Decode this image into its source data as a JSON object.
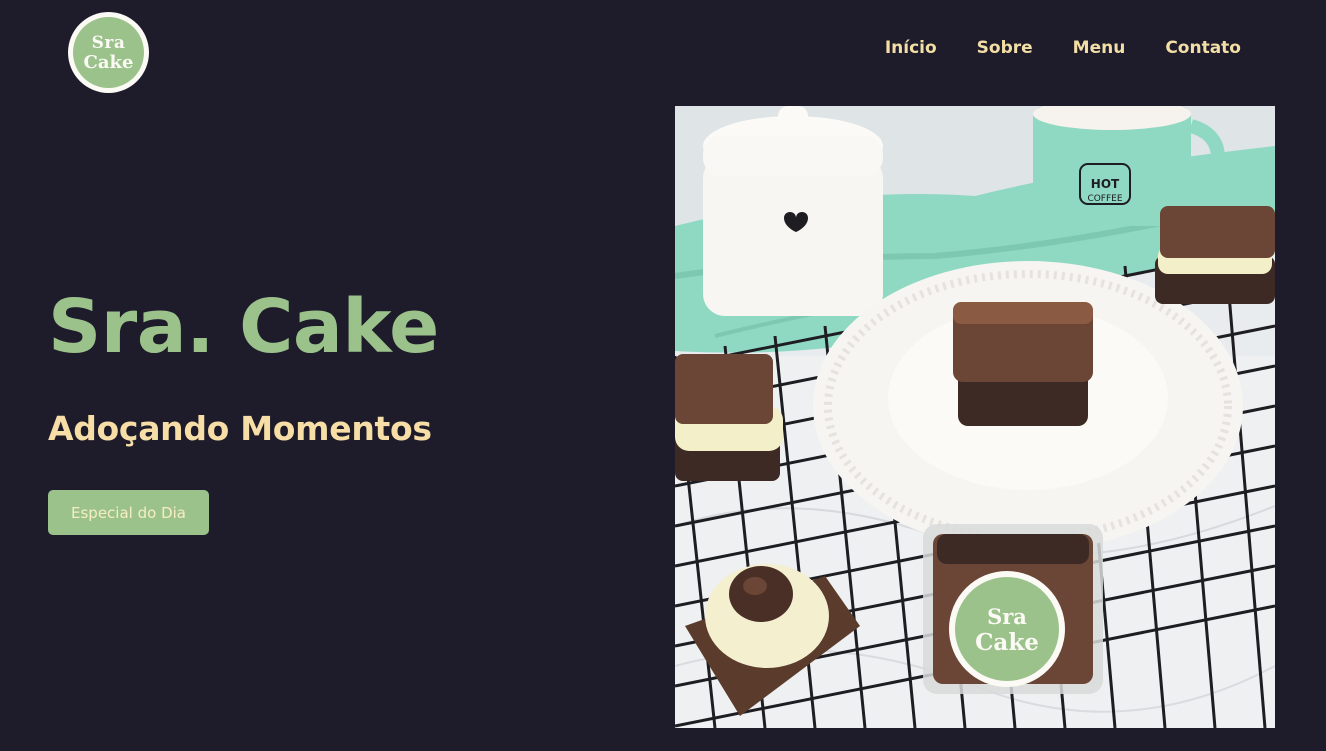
{
  "brand": {
    "logo_line1": "Sra",
    "logo_line2": "Cake"
  },
  "nav": {
    "items": [
      "Início",
      "Sobre",
      "Menu",
      "Contato"
    ]
  },
  "hero": {
    "title": "Sra. Cake",
    "subtitle": "Adoçando Momentos",
    "cta_label": "Especial do Dia"
  },
  "photo": {
    "mug_text_line1": "HOT",
    "mug_text_line2": "COFFEE",
    "sticker_line1": "Sra",
    "sticker_line2": "Cake"
  },
  "colors": {
    "background": "#1e1b2b",
    "brand_green": "#9cc28c",
    "accent_cream": "#f6dea6",
    "mint": "#8fd8c2"
  }
}
